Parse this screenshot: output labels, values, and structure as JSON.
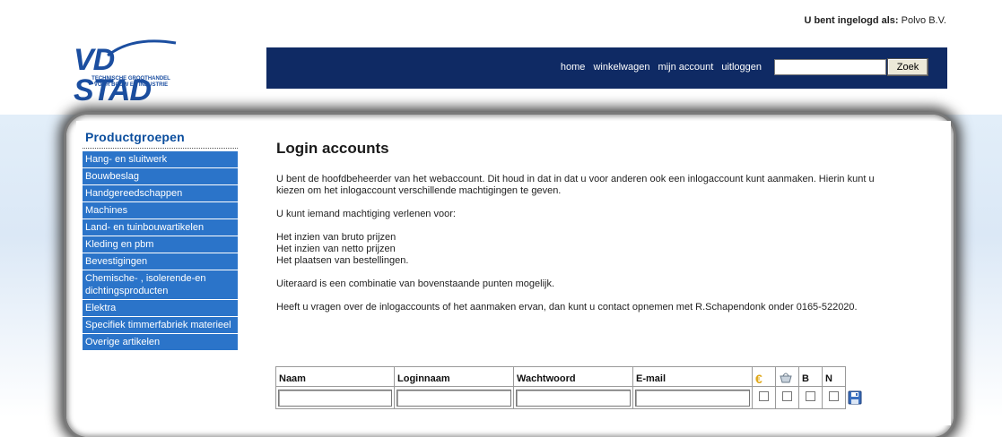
{
  "header": {
    "login_label": "U bent ingelogd als:",
    "login_user": "Polvo B.V."
  },
  "logo": {
    "title": "VD STAD",
    "subtitle_line1": "TECHNISCHE GROOTHANDEL",
    "subtitle_line2": "VOOR BOUW EN INDUSTRIE"
  },
  "nav": {
    "items": [
      "home",
      "winkelwagen",
      "mijn account",
      "uitloggen"
    ],
    "search_value": "",
    "search_button": "Zoek"
  },
  "sidebar": {
    "title": "Productgroepen",
    "items": [
      "Hang- en sluitwerk",
      "Bouwbeslag",
      "Handgereedschappen",
      "Machines",
      "Land- en tuinbouwartikelen",
      "Kleding en pbm",
      "Bevestigingen",
      "Chemische- , isolerende-en dichtingsproducten",
      "Elektra",
      "Specifiek timmerfabriek materieel",
      "Overige artikelen"
    ]
  },
  "content": {
    "title": "Login accounts",
    "p1": "U bent de hoofdbeheerder van het webaccount. Dit houd in dat in dat u voor anderen ook een inlogaccount kunt aanmaken. Hierin kunt u kiezen om het inlogaccount verschillende machtigingen te geven.",
    "p2": "U kunt iemand machtiging verlenen voor:",
    "list": [
      "Het inzien van bruto prijzen",
      "Het inzien van netto prijzen",
      "Het plaatsen van bestellingen."
    ],
    "p3": "Uiteraard is een combinatie van bovenstaande punten mogelijk.",
    "p4": "Heeft u vragen over de inlogaccounts of het aanmaken ervan, dan kunt u contact opnemen met R.Schapendonk onder 0165-522020."
  },
  "table": {
    "headers": [
      "Naam",
      "Loginnaam",
      "Wachtwoord",
      "E-mail"
    ],
    "euro_symbol": "€",
    "col_b": "B",
    "col_n": "N",
    "row": {
      "naam": "",
      "loginnaam": "",
      "wachtwoord": "",
      "email": ""
    },
    "colors": {
      "euro": "#e0a818"
    }
  },
  "colors": {
    "topbar": "#0f2a64",
    "sidebar_item": "#2b74c9",
    "sidebar_title": "#0b4e9e",
    "logo": "#1b4ea0"
  }
}
